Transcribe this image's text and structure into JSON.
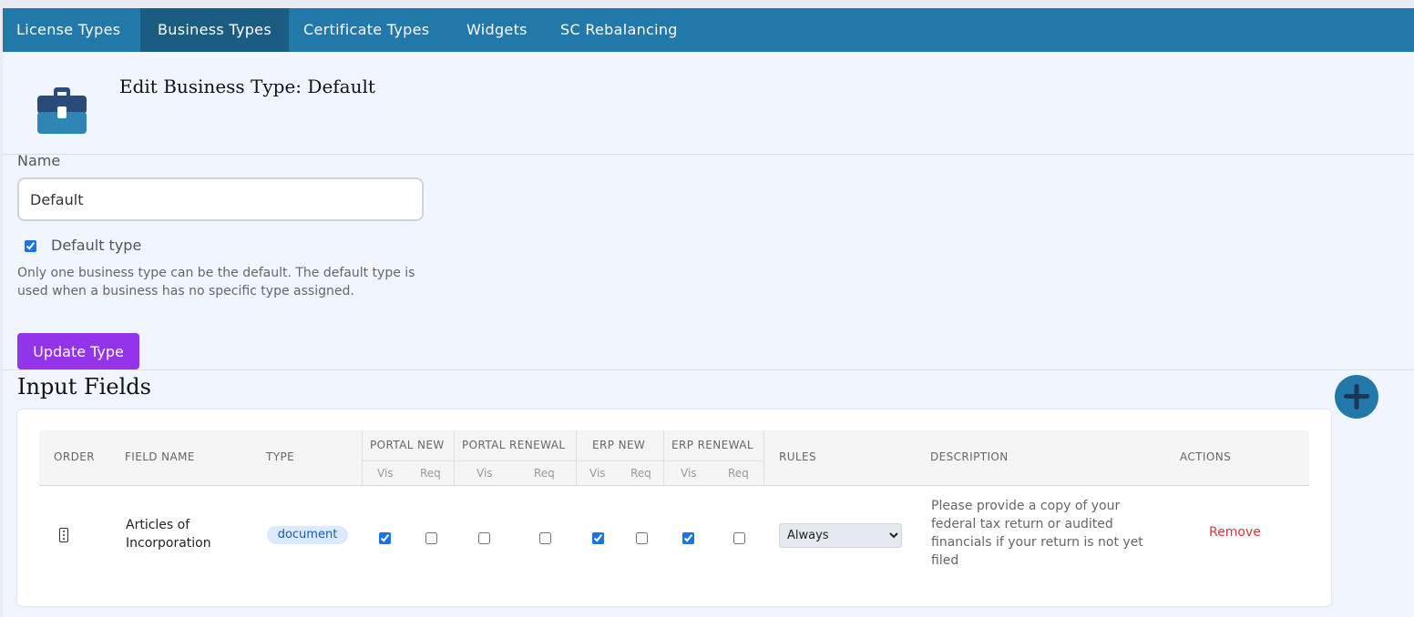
{
  "tabs": [
    {
      "label": "License Types",
      "active": false
    },
    {
      "label": "Business Types",
      "active": true
    },
    {
      "label": "Certificate Types",
      "active": false
    },
    {
      "label": "Widgets",
      "active": false
    },
    {
      "label": "SC Rebalancing",
      "active": false
    }
  ],
  "page": {
    "title": "Edit Business Type: Default",
    "icon": "briefcase-icon"
  },
  "form": {
    "name_label": "Name",
    "name_value": "Default",
    "default_checked": true,
    "default_label": "Default type",
    "help_text": "Only one business type can be the default. The default type is used when a business has no specific type assigned.",
    "update_button": "Update Type"
  },
  "input_fields": {
    "title": "Input Fields",
    "add_icon": "plus-icon",
    "headers": {
      "order": "ORDER",
      "field_name": "FIELD NAME",
      "type": "TYPE",
      "portal_new": "PORTAL NEW",
      "portal_renewal": "PORTAL RENEWAL",
      "erp_new": "ERP NEW",
      "erp_renewal": "ERP RENEWAL",
      "rules": "RULES",
      "description": "DESCRIPTION",
      "actions": "ACTIONS",
      "vis": "Vis",
      "req": "Req"
    },
    "rows": [
      {
        "field_name": "Articles of Incorporation",
        "type": "document",
        "portal_new_vis": true,
        "portal_new_req": false,
        "portal_renewal_vis": false,
        "portal_renewal_req": false,
        "erp_new_vis": true,
        "erp_new_req": false,
        "erp_renewal_vis": true,
        "erp_renewal_req": false,
        "rule": "Always",
        "rule_options": [
          "Always"
        ],
        "description": "Please provide a copy of your federal tax return or audited financials if your return is not yet filed",
        "action": "Remove"
      }
    ]
  },
  "colors": {
    "nav": "#2178a9",
    "nav_active": "#1b5c82",
    "primary_button": "#9333ea",
    "danger": "#d03a3a",
    "badge_bg": "#dbeafe"
  }
}
